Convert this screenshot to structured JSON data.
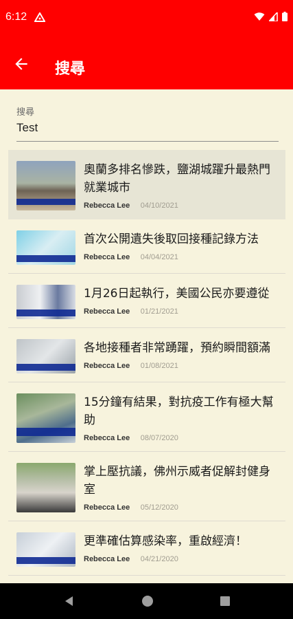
{
  "status_bar": {
    "time": "6:12"
  },
  "app_bar": {
    "title": "搜尋"
  },
  "search": {
    "label": "搜尋",
    "value": "Test"
  },
  "results": [
    {
      "title": "奧蘭多排名慘跌，鹽湖城躍升最熱門就業城市",
      "author": "Rebecca Lee",
      "date": "04/10/2021",
      "highlighted": true
    },
    {
      "title": "首次公開遺失後取回接種記錄方法",
      "author": "Rebecca Lee",
      "date": "04/04/2021"
    },
    {
      "title": "1月26日起執行，美國公民亦要遵從",
      "author": "Rebecca Lee",
      "date": "01/21/2021"
    },
    {
      "title": "各地接種者非常踴躍，預約瞬間額滿",
      "author": "Rebecca Lee",
      "date": "01/08/2021"
    },
    {
      "title": "15分鐘有結果，對抗疫工作有極大幫助",
      "author": "Rebecca Lee",
      "date": "08/07/2020"
    },
    {
      "title": "掌上壓抗議，佛州示威者促解封健身室",
      "author": "Rebecca Lee",
      "date": "05/12/2020"
    },
    {
      "title": "更準確估算感染率，重啟經濟！",
      "author": "Rebecca Lee",
      "date": "04/21/2020"
    }
  ],
  "icons": {
    "back": "arrow-left-icon",
    "wifi": "wifi-icon",
    "signal": "signal-icon",
    "battery": "battery-icon",
    "notification": "app-notification-icon",
    "nav_back": "nav-back-icon",
    "nav_home": "nav-home-icon",
    "nav_recents": "nav-recents-icon"
  },
  "colors": {
    "accent": "#ff0000",
    "background": "#f7f3dd",
    "highlight": "#e7e5d5"
  }
}
